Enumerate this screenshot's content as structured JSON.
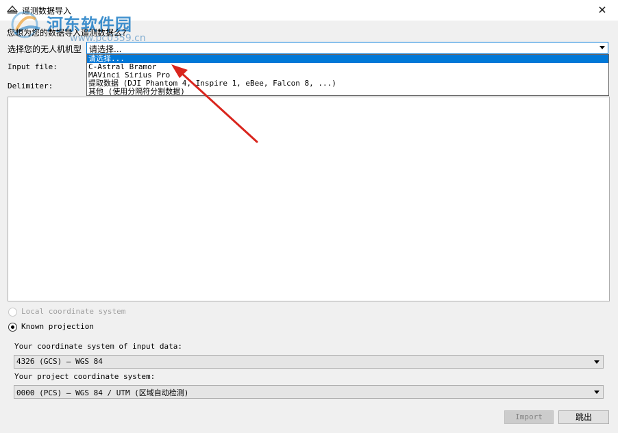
{
  "window": {
    "title": "遥测数据导入"
  },
  "watermark": {
    "text": "河东软件园",
    "url": "www.pc0359.cn"
  },
  "form": {
    "question": "您想为您的数据导入遥测数据么?",
    "drone_label": "选择您的无人机机型",
    "drone_selected": "请选择...",
    "drone_options": [
      "请选择...",
      "C-Astral Bramor",
      "MAVinci Sirius Pro",
      "提取数据 (DJI Phantom 4, Inspire 1, eBee, Falcon 8, ...)",
      "其他 (使用分隔符分割数据)"
    ],
    "input_file_label": "Input file:",
    "delimiter_label": "Delimiter:"
  },
  "coordinates": {
    "local_label": "Local coordinate system",
    "known_label": "Known projection",
    "selected_mode": "Known projection",
    "input_label": "Your coordinate system of input data:",
    "input_value": "4326 (GCS) — WGS 84",
    "project_label": "Your project coordinate system:",
    "project_value": "0000 (PCS) — WGS 84 / UTM (区域自动检测)"
  },
  "buttons": {
    "import_label": "Import",
    "skip_label": "跳出"
  },
  "colors": {
    "accent": "#0078d7",
    "annotation_arrow": "#d9251d",
    "watermark": "#1f7ec6"
  }
}
